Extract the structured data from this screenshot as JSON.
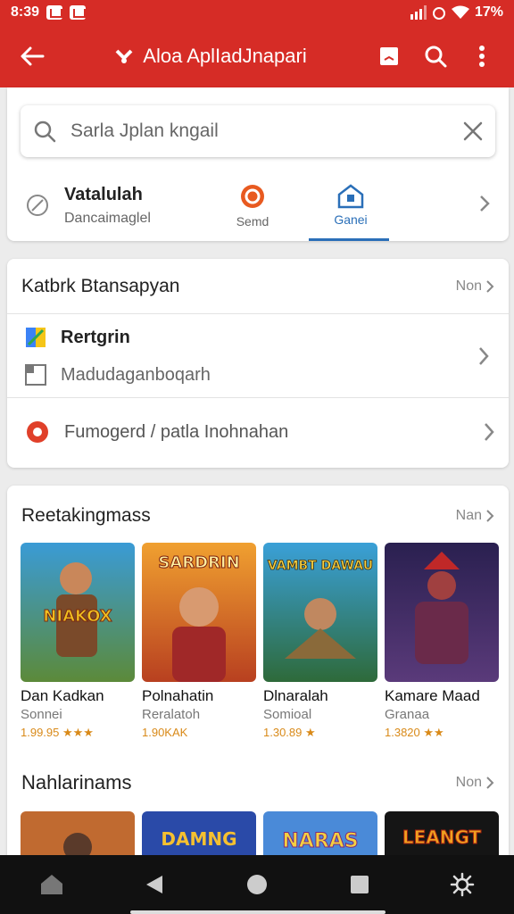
{
  "status": {
    "time": "8:39",
    "battery": "17%"
  },
  "toolbar": {
    "title": "Aloa AplIadJnapari"
  },
  "search": {
    "placeholder": "Sarla Jplan kngail"
  },
  "top": {
    "lead_title": "Vatalulah",
    "lead_sub": "Dancaimaglel",
    "tabs": [
      {
        "label": "Semd"
      },
      {
        "label": "Ganei"
      }
    ]
  },
  "categories": {
    "title": "Katbrk Btansapyan",
    "more": "Non",
    "items": [
      {
        "label": "Rertgrin"
      },
      {
        "label": "Madudaganboqarh"
      },
      {
        "label": "Fumogerd / patla Inohnahan"
      }
    ]
  },
  "recommended": {
    "title": "Reetakingmass",
    "more": "Nan",
    "games": [
      {
        "name": "Dan Kadkan",
        "category": "Sonnei",
        "rating": "1.99.95 ★★★",
        "art_text": "NIAKOX"
      },
      {
        "name": "Polnahatin",
        "category": "Reralatoh",
        "rating": "1.90KAK",
        "art_text": "SARDRIN"
      },
      {
        "name": "Dlnaralah",
        "category": "Somioal",
        "rating": "1.30.89 ★",
        "art_text": "VAMBT DAWAU"
      },
      {
        "name": "Kamare Maad",
        "category": "Granaa",
        "rating": "1.3820 ★★",
        "art_text": ""
      }
    ]
  },
  "section2": {
    "title": "Nahlarinams",
    "more": "Non",
    "art": [
      "",
      "DAMNG",
      "NARAS",
      "LEANGT"
    ]
  },
  "colors": {
    "brand": "#d62c26",
    "accent": "#2a6fb8",
    "star": "#e6a519"
  }
}
